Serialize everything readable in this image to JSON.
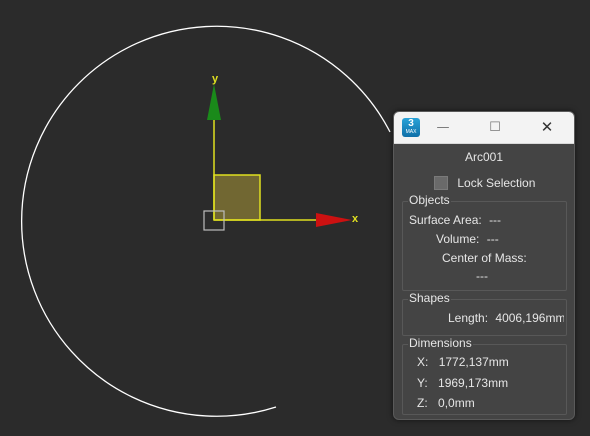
{
  "viewport": {
    "axis_x_label": "x",
    "axis_y_label": "y",
    "colors": {
      "background": "#2b2b2b",
      "arc": "#ffffff",
      "axis_yellow": "#e0e020",
      "axis_x_arrow": "#cc1111",
      "axis_y_arrow": "#1a8a1a",
      "plane_handle": "#8a7a2a"
    }
  },
  "dialog": {
    "app_logo_text": "3",
    "app_logo_sub": "MAX",
    "minimize_glyph": "—",
    "maximize_glyph": "☐",
    "close_glyph": "✕",
    "object_name": "Arc001",
    "lock_selection_label": "Lock Selection",
    "lock_selection_checked": false,
    "objects": {
      "title": "Objects",
      "surface_area_label": "Surface Area:",
      "surface_area_value": "---",
      "volume_label": "Volume:",
      "volume_value": "---",
      "center_of_mass_label": "Center of Mass:",
      "center_of_mass_value": "---"
    },
    "shapes": {
      "title": "Shapes",
      "length_label": "Length:",
      "length_value": "4006,196mm"
    },
    "dimensions": {
      "title": "Dimensions",
      "x_label": "X:",
      "x_value": "1772,137mm",
      "y_label": "Y:",
      "y_value": "1969,173mm",
      "z_label": "Z:",
      "z_value": "0,0mm"
    }
  }
}
